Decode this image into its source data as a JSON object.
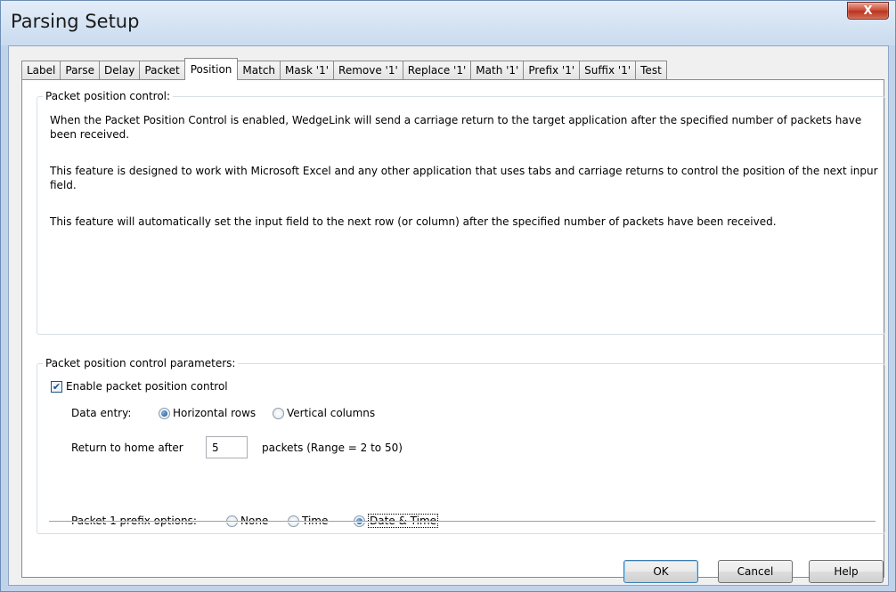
{
  "window": {
    "title": "Parsing Setup",
    "close_label": "X"
  },
  "tabs": [
    {
      "label": "Label"
    },
    {
      "label": "Parse"
    },
    {
      "label": "Delay"
    },
    {
      "label": "Packet"
    },
    {
      "label": "Position"
    },
    {
      "label": "Match"
    },
    {
      "label": "Mask '1'"
    },
    {
      "label": "Remove '1'"
    },
    {
      "label": "Replace '1'"
    },
    {
      "label": "Math '1'"
    },
    {
      "label": "Prefix '1'"
    },
    {
      "label": "Suffix '1'"
    },
    {
      "label": "Test"
    }
  ],
  "active_tab": "Position",
  "control_group": {
    "title": "Packet position control:",
    "paragraphs": [
      "When the Packet Position Control is enabled, WedgeLink will send a carriage return to the target application after the specified number of packets have been received.",
      "This feature is designed to work with Microsoft Excel and any other application that uses tabs and carriage returns to control the position of the next inpur field.",
      "This feature will automatically set the input field to the next row (or column) after the specified number of packets have been received."
    ]
  },
  "params_group": {
    "title": "Packet position control parameters:",
    "enable_checkbox": {
      "label": "Enable packet position control",
      "checked": true
    },
    "data_entry": {
      "label": "Data entry:",
      "options": [
        "Horizontal rows",
        "Vertical columns"
      ],
      "selected": "Horizontal rows"
    },
    "return_home": {
      "label": "Return to home after",
      "value": "5",
      "suffix": "packets  (Range = 2 to 50)"
    },
    "prefix_options": {
      "label": "Packet 1 prefix options:",
      "options": [
        "None",
        "Time",
        "Date & Time"
      ],
      "selected": "Date & Time"
    }
  },
  "buttons": {
    "ok": "OK",
    "cancel": "Cancel",
    "help": "Help"
  }
}
